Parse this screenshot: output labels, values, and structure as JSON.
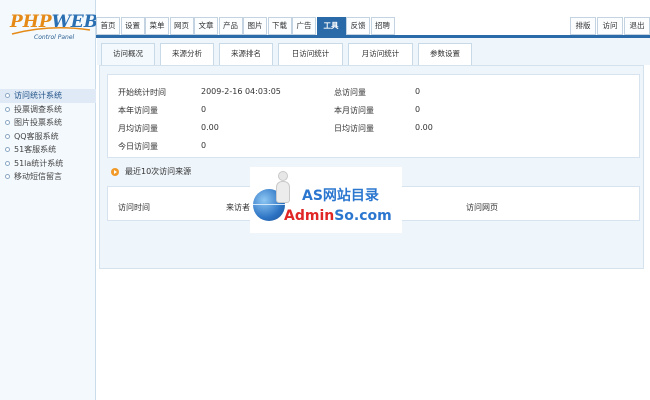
{
  "logo": {
    "part1": "PHP",
    "part2": "WEB",
    "subtitle": "Control Panel"
  },
  "nav": {
    "tabs": [
      "首页",
      "设置",
      "菜单",
      "网页",
      "文章",
      "产品",
      "图片",
      "下载",
      "广告",
      "工具",
      "反馈",
      "招聘"
    ],
    "active_index": 9,
    "right": [
      "排版",
      "访问",
      "退出"
    ]
  },
  "sidebar": {
    "items": [
      "访问统计系统",
      "投票调查系统",
      "图片投票系统",
      "QQ客服系统",
      "51客服系统",
      "51la统计系统",
      "移动短信留言"
    ],
    "active_index": 0
  },
  "subtabs": {
    "items": [
      "访问概况",
      "来源分析",
      "来源排名",
      "日访问统计",
      "月访问统计",
      "参数设置"
    ],
    "active_index": 0
  },
  "stats": {
    "start_label": "开始统计时间",
    "start_value": "2009-2-16 04:03:05",
    "total_label": "总访问量",
    "total_value": "0",
    "year_label": "本年访问量",
    "year_value": "0",
    "month_label": "本月访问量",
    "month_value": "0",
    "monthly_avg_label": "月均访问量",
    "monthly_avg_value": "0.00",
    "daily_avg_label": "日均访问量",
    "daily_avg_value": "0.00",
    "today_label": "今日访问量",
    "today_value": "0"
  },
  "recent": {
    "title": "最近10次访问来源",
    "columns": [
      "访问时间",
      "来访者IP",
      "访问网页"
    ]
  },
  "watermark": {
    "title": "AS网站目录",
    "url_a": "Admin",
    "url_b": "So.com"
  }
}
